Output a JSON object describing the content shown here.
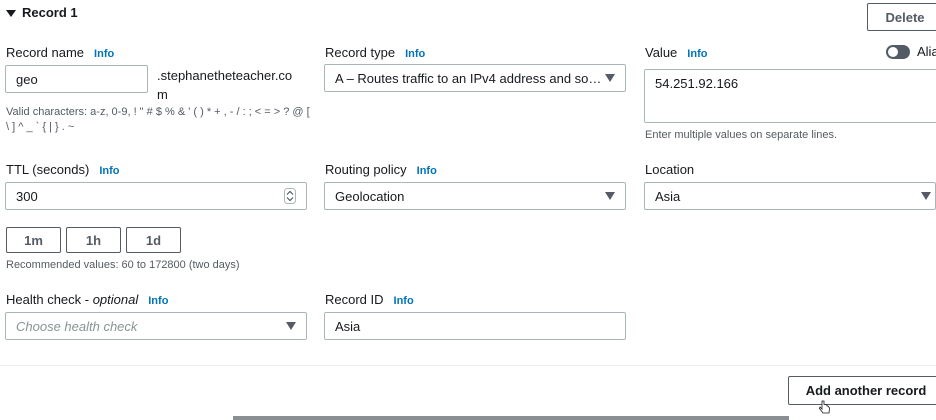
{
  "record": {
    "title": "Record 1",
    "delete_label": "Delete"
  },
  "record_name": {
    "label": "Record name",
    "info": "Info",
    "value": "geo",
    "suffix_line1": ".stephanetheteacher.co",
    "suffix_line2": "m",
    "hint_line1": "Valid characters: a-z, 0-9, ! \" # $ % & ' ( ) * + , - / : ; < = > ? @ [",
    "hint_line2": "\\ ] ^ _ ` { | } . ~"
  },
  "record_type": {
    "label": "Record type",
    "info": "Info",
    "value": "A – Routes traffic to an IPv4 address and so…"
  },
  "value_field": {
    "label": "Value",
    "info": "Info",
    "alias_label": "Alia",
    "value": "54.251.92.166",
    "hint": "Enter multiple values on separate lines."
  },
  "ttl": {
    "label": "TTL (seconds)",
    "info": "Info",
    "value": "300",
    "presets": [
      "1m",
      "1h",
      "1d"
    ],
    "hint": "Recommended values: 60 to 172800 (two days)"
  },
  "routing_policy": {
    "label": "Routing policy",
    "info": "Info",
    "value": "Geolocation"
  },
  "location": {
    "label": "Location",
    "value": "Asia"
  },
  "health_check": {
    "label": "Health check - ",
    "optional": "optional",
    "info": "Info",
    "placeholder": "Choose health check"
  },
  "record_id": {
    "label": "Record ID",
    "info": "Info",
    "value": "Asia"
  },
  "footer": {
    "add_label": "Add another record"
  },
  "colors": {
    "link": "#0073bb",
    "border": "#aab7b8",
    "text": "#16191f",
    "muted": "#545b64"
  }
}
